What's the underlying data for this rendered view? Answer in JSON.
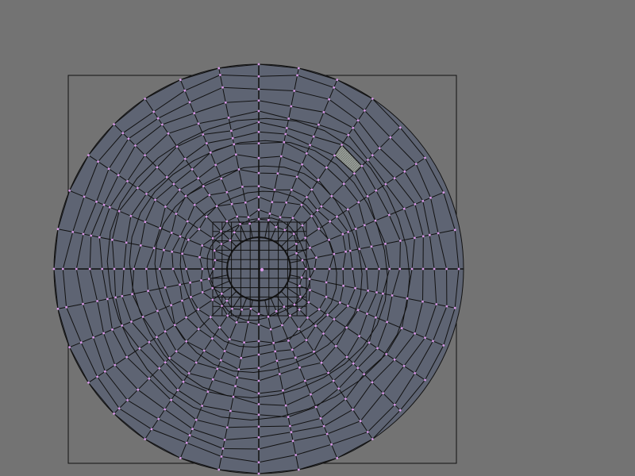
{
  "editor": {
    "mode": "uv-face-select",
    "colors": {
      "background": "#737373",
      "mesh_fill": "#5e6473",
      "edge": "#111111",
      "vertex": "#d898e8",
      "selected_face": "#9aa09a",
      "image_bounds": "#111111"
    },
    "mesh": {
      "rings": 14,
      "spokes": 32,
      "selected_face": {
        "ring": 9,
        "spoke": 3
      }
    }
  }
}
